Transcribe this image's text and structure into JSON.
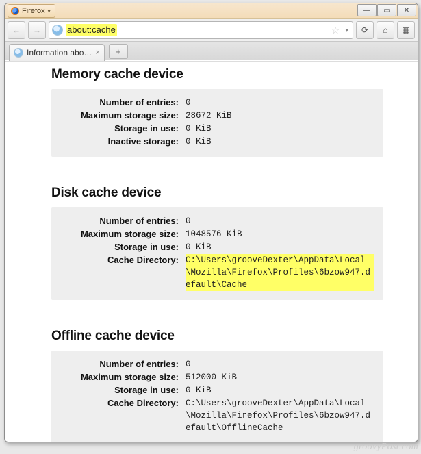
{
  "titlebar": {
    "app_name": "Firefox"
  },
  "win_controls": {
    "min": "—",
    "max": "▭",
    "close": "✕"
  },
  "navbar": {
    "back": "←",
    "forward": "→",
    "reload": "⟳",
    "url": "about:cache",
    "star": "☆",
    "dropdown": "▾",
    "home": "⌂",
    "feed": "▦"
  },
  "tabs": {
    "active_title": "Information abo…",
    "close": "×",
    "newtab": "+"
  },
  "sections": [
    {
      "title": "Memory cache device",
      "rows": [
        {
          "label": "Number of entries:",
          "value": "0"
        },
        {
          "label": "Maximum storage size:",
          "value": "28672 KiB"
        },
        {
          "label": "Storage in use:",
          "value": "0 KiB"
        },
        {
          "label": "Inactive storage:",
          "value": "0 KiB"
        }
      ]
    },
    {
      "title": "Disk cache device",
      "rows": [
        {
          "label": "Number of entries:",
          "value": "0"
        },
        {
          "label": "Maximum storage size:",
          "value": "1048576 KiB"
        },
        {
          "label": "Storage in use:",
          "value": "0 KiB"
        },
        {
          "label": "Cache Directory:",
          "value": "C:\\Users\\grooveDexter\\AppData\\Local\\Mozilla\\Firefox\\Profiles\\6bzow947.default\\Cache",
          "highlight": true
        }
      ]
    },
    {
      "title": "Offline cache device",
      "rows": [
        {
          "label": "Number of entries:",
          "value": "0"
        },
        {
          "label": "Maximum storage size:",
          "value": "512000 KiB"
        },
        {
          "label": "Storage in use:",
          "value": "0 KiB"
        },
        {
          "label": "Cache Directory:",
          "value": "C:\\Users\\grooveDexter\\AppData\\Local\\Mozilla\\Firefox\\Profiles\\6bzow947.default\\OfflineCache"
        }
      ]
    }
  ],
  "watermark": "groovyPost.com"
}
